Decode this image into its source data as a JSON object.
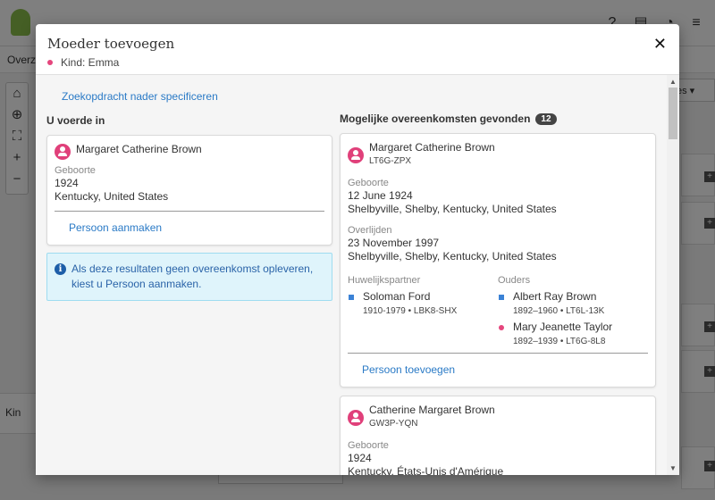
{
  "background": {
    "sub_text": "Overz",
    "kind_label": "Kin",
    "dropdown_text": "es ▾"
  },
  "modal": {
    "title": "Moeder toevoegen",
    "subtitle": "Kind: Emma",
    "refine_link": "Zoekopdracht nader specificeren"
  },
  "entered": {
    "heading": "U voerde in",
    "name": "Margaret Catherine Brown",
    "birth_label": "Geboorte",
    "birth_date": "1924",
    "birth_place": "Kentucky, United States",
    "create_link": "Persoon aanmaken"
  },
  "info": {
    "text": "Als deze resultaten geen overeenkomst opleveren, kiest u Persoon aanmaken."
  },
  "matches": {
    "heading": "Mogelijke overeenkomsten gevonden",
    "count": "12",
    "results": [
      {
        "name": "Margaret Catherine Brown",
        "pid": "LT6G-ZPX",
        "birth_label": "Geboorte",
        "birth_date": "12 June 1924",
        "birth_place": "Shelbyville, Shelby, Kentucky, United States",
        "death_label": "Overlijden",
        "death_date": "23 November 1997",
        "death_place": "Shelbyville, Shelby, Kentucky, United States",
        "spouse_label": "Huwelijkspartner",
        "spouse_name": "Soloman Ford",
        "spouse_meta": "1910-1979 • LBK8-SHX",
        "parents_label": "Ouders",
        "father_name": "Albert Ray Brown",
        "father_meta": "1892–1960 • LT6L-13K",
        "mother_name": "Mary Jeanette Taylor",
        "mother_meta": "1892–1939 • LT6G-8L8",
        "add_link": "Persoon toevoegen"
      },
      {
        "name": "Catherine Margaret Brown",
        "pid": "GW3P-YQN",
        "birth_label": "Geboorte",
        "birth_date": "1924",
        "birth_place": "Kentucky, États-Unis d'Amérique"
      }
    ]
  }
}
